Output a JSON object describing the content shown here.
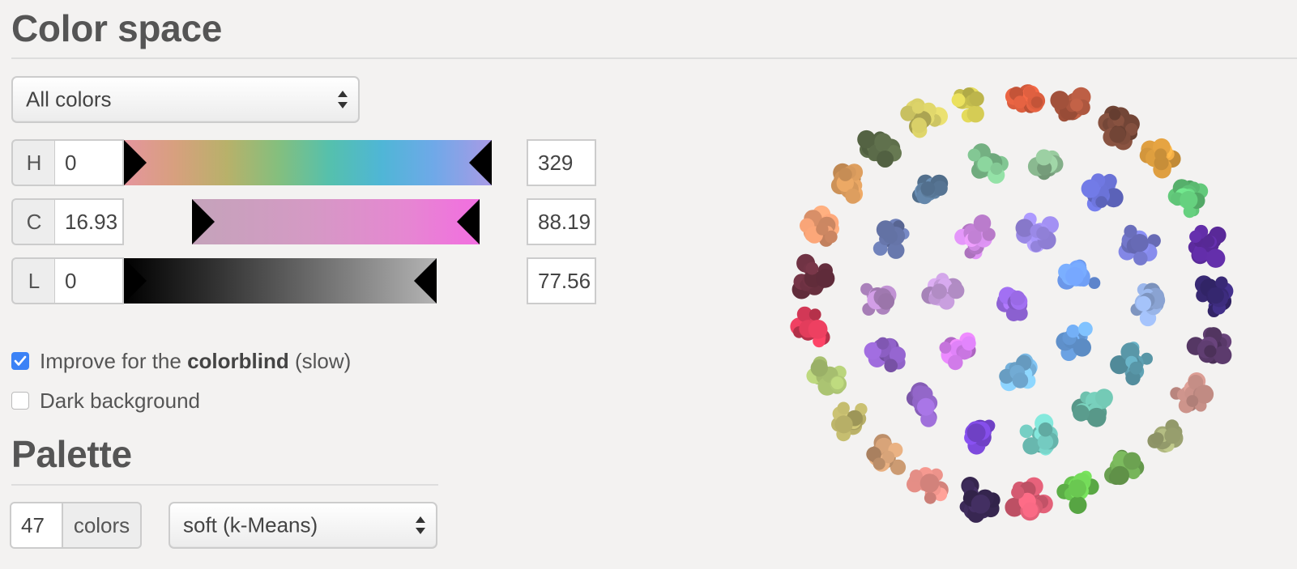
{
  "color_space": {
    "heading": "Color space",
    "preset_select": {
      "selected": "All colors"
    },
    "sliders": [
      {
        "label": "H",
        "min": "0",
        "max": "329"
      },
      {
        "label": "C",
        "min": "16.93",
        "max": "88.19"
      },
      {
        "label": "L",
        "min": "0",
        "max": "77.56"
      }
    ],
    "options": {
      "colorblind": {
        "prefix": "Improve for the ",
        "bold": "colorblind",
        "suffix": " (slow)",
        "checked": true
      },
      "dark_background": {
        "label": "Dark background",
        "checked": false
      }
    }
  },
  "palette": {
    "heading": "Palette",
    "count": "47",
    "count_unit": "colors",
    "method_select": {
      "selected": "soft (k-Means)"
    }
  },
  "swatch_colors": [
    "#9a6ae6",
    "#9b8ae8",
    "#6e9cf0",
    "#6fa8ec",
    "#7ab8e4",
    "#d07ae8",
    "#c39ad8",
    "#d08ae4",
    "#6a72d6",
    "#7a7ed6",
    "#8ea8d8",
    "#5ea0b2",
    "#6ab8a6",
    "#72c8be",
    "#7a48d8",
    "#9266c8",
    "#8a5ec0",
    "#b488c6",
    "#6a7ab0",
    "#5a7a9a",
    "#7ec08e",
    "#8ab890",
    "#62c87a",
    "#5a2a9a",
    "#3a2a78",
    "#5a3a6a",
    "#c89088",
    "#a8b07a",
    "#6aa050",
    "#68c450",
    "#e26078",
    "#3c2a58",
    "#e89088",
    "#c89870",
    "#b8b068",
    "#a8c070",
    "#d83a58",
    "#6a3040",
    "#e89a70",
    "#e0a060",
    "#5a6a48",
    "#c8c060",
    "#c8c050",
    "#e06040",
    "#b05840",
    "#7a4a3a",
    "#e0a040"
  ]
}
